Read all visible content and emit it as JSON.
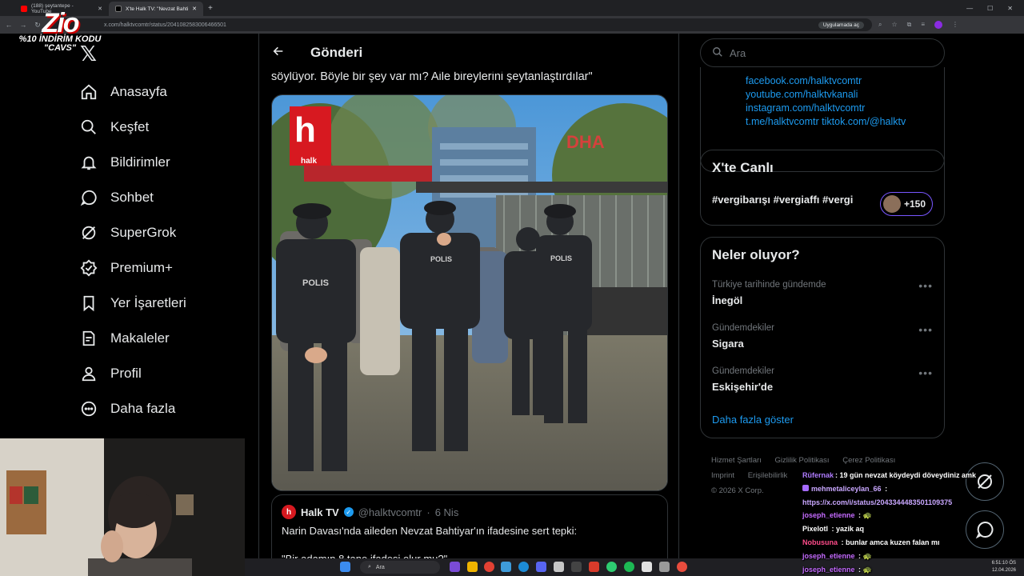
{
  "browser": {
    "tabs": [
      {
        "title": "(188) şeytantepe - YouTube",
        "active": false
      },
      {
        "title": "X'te Halk TV: \"Nevzat Bahti...",
        "active": true
      }
    ],
    "url": "x.com/halktvcomtr/status/2041082583006466501",
    "app_button": "Uygulamada aç"
  },
  "overlay": {
    "logo": "Zio",
    "promo_line1": "%10 İNDİRİM KODU",
    "promo_line2": "\"CAVS\""
  },
  "nav": {
    "items": [
      {
        "label": "Anasayfa",
        "icon": "home-icon"
      },
      {
        "label": "Keşfet",
        "icon": "search-icon"
      },
      {
        "label": "Bildirimler",
        "icon": "bell-icon"
      },
      {
        "label": "Sohbet",
        "icon": "chat-icon"
      },
      {
        "label": "SuperGrok",
        "icon": "grok-icon"
      },
      {
        "label": "Premium+",
        "icon": "verified-icon"
      },
      {
        "label": "Yer İşaretleri",
        "icon": "bookmark-icon"
      },
      {
        "label": "Makaleler",
        "icon": "article-icon"
      },
      {
        "label": "Profil",
        "icon": "person-icon"
      },
      {
        "label": "Daha fazla",
        "icon": "more-icon"
      }
    ]
  },
  "post": {
    "header_title": "Gönderi",
    "text_tail": "söylüyor. Böyle bir şey var mı? Aile bireylerini şeytanlaştırdılar\"",
    "media": {
      "halk_watermark": "halk",
      "dha_watermark": "DHA",
      "vest_labels": [
        "POLIS",
        "POLIS",
        "POLIS"
      ]
    },
    "quote": {
      "name": "Halk TV",
      "handle": "@halktvcomtr",
      "date": "6 Nis",
      "body": "Narin Davası'nda aileden Nevzat Bahtiyar'ın ifadesine sert tepki:",
      "body2": "\"Bir adamın 8 tane ifadesi olur mu?\""
    }
  },
  "right": {
    "search_placeholder": "Ara",
    "links": [
      "facebook.com/halktvcomtr",
      "youtube.com/halktvkanali",
      "instagram.com/halktvcomtr",
      "t.me/halktvcomtr tiktok.com/@halktv"
    ],
    "live": {
      "title": "X'te Canlı",
      "tags": "#vergibarışı #vergiaffı #vergi",
      "count": "+150"
    },
    "trending": {
      "title": "Neler oluyor?",
      "items": [
        {
          "category": "Türkiye tarihinde gündemde",
          "name": "İnegöl"
        },
        {
          "category": "Gündemdekiler",
          "name": "Sigara"
        },
        {
          "category": "Gündemdekiler",
          "name": "Eskişehir'de"
        }
      ],
      "show_more": "Daha fazla göster"
    },
    "footer": {
      "links": [
        "Hizmet Şartları",
        "Gizlilik Politikası",
        "Çerez Politikası",
        "Imprint",
        "Erişilebilirlik"
      ],
      "copyright": "© 2026 X Corp."
    }
  },
  "chat": [
    {
      "user": "Rüfernak",
      "color": "#b07cff",
      "msg": "19 gün nevzat köydeydi döveydiniz amk"
    },
    {
      "user": "mehmetaliceylan_66",
      "color": "#c9a7ff",
      "msg": ""
    },
    {
      "user": "",
      "color": "#c9a7ff",
      "msg": "https://x.com/i/status/2043344483501109375"
    },
    {
      "user": "joseph_etienne",
      "color": "#c56bff",
      "msg": ""
    },
    {
      "user": "Pixelotl",
      "color": "#ffffff",
      "msg": "yazik aq"
    },
    {
      "user": "Nobusuna",
      "color": "#ff4c8b",
      "msg": "bunlar amca kuzen falan mı"
    },
    {
      "user": "joseph_etienne",
      "color": "#c56bff",
      "msg": ""
    },
    {
      "user": "joseph_etienne",
      "color": "#c56bff",
      "msg": ""
    }
  ],
  "taskbar": {
    "search": "Ara",
    "time": "6:51:10 ÖS",
    "date": "12.04.2026"
  }
}
